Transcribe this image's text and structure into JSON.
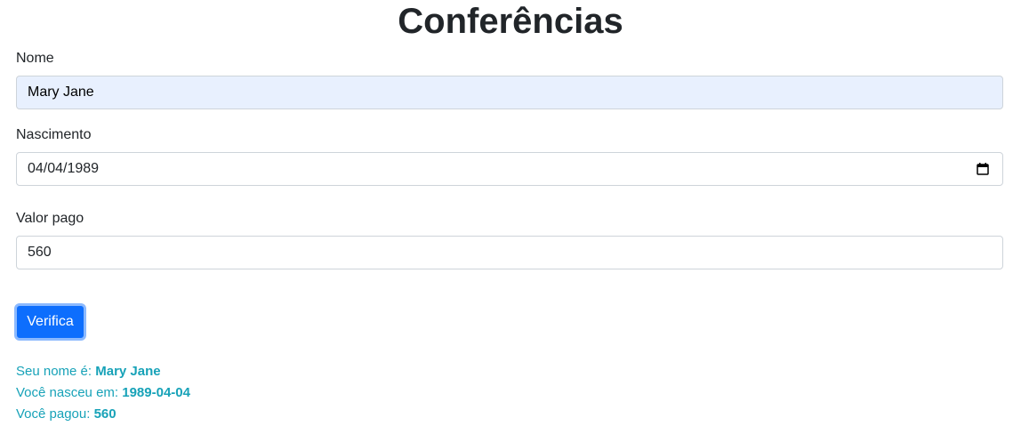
{
  "page": {
    "title": "Conferências"
  },
  "form": {
    "name_label": "Nome",
    "name_value": "Mary Jane",
    "birth_label": "Nascimento",
    "birth_value": "04/04/1989",
    "paid_label": "Valor pago",
    "paid_value": "560",
    "button_label": "Verifica"
  },
  "results": {
    "name_prefix": "Seu nome é:",
    "name_value": "Mary Jane",
    "birth_prefix": "Você nasceu em:",
    "birth_value": "1989-04-04",
    "paid_prefix": "Você pagou:",
    "paid_value": "560"
  },
  "icons": {
    "date_picker": "calendar-icon"
  },
  "colors": {
    "button": "#0d6efd",
    "result_text": "#17a2b8",
    "autofill": "#e8f0fe"
  }
}
